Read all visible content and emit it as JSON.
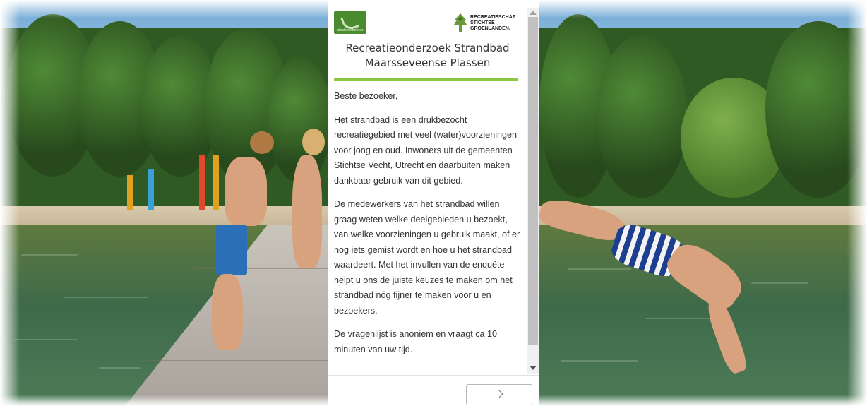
{
  "logos": {
    "left_text": "staatsbosbeheer",
    "right_text": [
      "RECREATIESCHAP",
      "STICHTSE",
      "GROENLANDEN."
    ]
  },
  "survey": {
    "title_line1": "Recreatieonderzoek Strandbad",
    "title_line2": "Maarsseveense Plassen",
    "greeting": "Beste bezoeker,",
    "paragraph1": "Het strandbad is een drukbezocht recreatiegebied met veel (water)voorzieningen voor jong en oud. Inwoners uit de gemeenten Stichtse Vecht, Utrecht en daarbuiten maken dankbaar gebruik van dit gebied.",
    "paragraph2": "De medewerkers van het strandbad willen graag weten welke deelgebieden u bezoekt, van welke voorzieningen u gebruik maakt, of er nog iets gemist wordt en hoe u het strandbad waardeert. Met het invullen van de enquête helpt u ons de juiste keuzes te maken om het strandbad nóg fijner te maken voor u en bezoekers.",
    "paragraph3": "De vragenlijst is anoniem en vraagt ca 10 minuten van uw tijd."
  },
  "navigation": {
    "next_icon": "chevron-right-icon"
  },
  "colors": {
    "accent_rule": "#8dc63f",
    "logo_green": "#4a8b2f"
  }
}
